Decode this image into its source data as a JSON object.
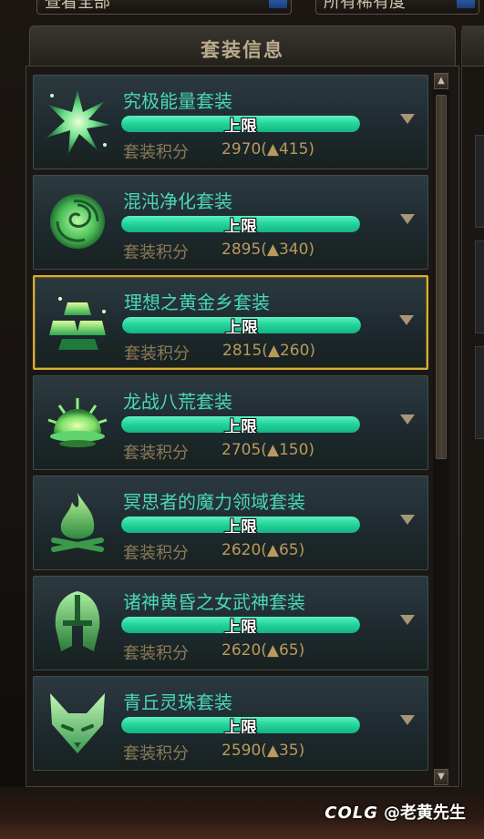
{
  "top_filters": {
    "left_value": "查看全部",
    "right_value": "所有稀有度"
  },
  "panel": {
    "title": "套装信息"
  },
  "score_label": "套装积分",
  "bar_label": "上限",
  "sets": [
    {
      "name": "究极能量套装",
      "score": "2970",
      "increase": "(▲415)",
      "bar_fraction": 1.0,
      "icon": "energy-burst-icon",
      "selected": false
    },
    {
      "name": "混沌净化套装",
      "score": "2895",
      "increase": "(▲340)",
      "bar_fraction": 1.0,
      "icon": "rose-icon",
      "selected": false
    },
    {
      "name": "理想之黄金乡套装",
      "score": "2815",
      "increase": "(▲260)",
      "bar_fraction": 1.0,
      "icon": "gold-bars-icon",
      "selected": true
    },
    {
      "name": "龙战八荒套装",
      "score": "2705",
      "increase": "(▲150)",
      "bar_fraction": 1.0,
      "icon": "sunrise-icon",
      "selected": false
    },
    {
      "name": "冥思者的魔力领域套装",
      "score": "2620",
      "increase": "(▲65)",
      "bar_fraction": 1.0,
      "icon": "flame-icon",
      "selected": false
    },
    {
      "name": "诸神黄昏之女武神套装",
      "score": "2620",
      "increase": "(▲65)",
      "bar_fraction": 1.0,
      "icon": "helmet-icon",
      "selected": false
    },
    {
      "name": "青丘灵珠套装",
      "score": "2590",
      "increase": "(▲35)",
      "bar_fraction": 1.0,
      "icon": "fox-icon",
      "selected": false
    }
  ],
  "watermark": {
    "brand": "COLG",
    "author": "@老黄先生"
  },
  "colors": {
    "name_text": "#49d7b8",
    "bar_fill": "#22d39a",
    "score_text": "#b9995d",
    "selected_border": "#d7b03a"
  }
}
